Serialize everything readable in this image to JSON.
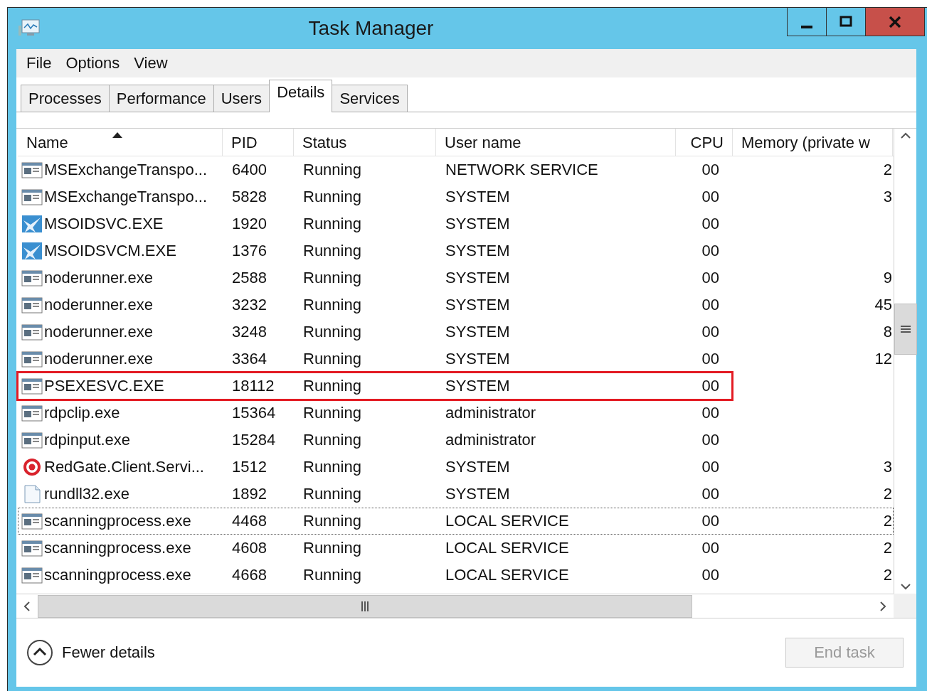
{
  "window": {
    "title": "Task Manager",
    "controls": [
      {
        "kind": "minimize"
      },
      {
        "kind": "maximize"
      },
      {
        "kind": "close"
      }
    ]
  },
  "menu": [
    "File",
    "Options",
    "View"
  ],
  "tabs": [
    {
      "label": "Processes",
      "selected": false
    },
    {
      "label": "Performance",
      "selected": false
    },
    {
      "label": "Users",
      "selected": false
    },
    {
      "label": "Details",
      "selected": true
    },
    {
      "label": "Services",
      "selected": false
    }
  ],
  "table": {
    "columns": [
      {
        "label": "Name",
        "sorted": true
      },
      {
        "label": "PID",
        "sorted": false
      },
      {
        "label": "Status",
        "sorted": false
      },
      {
        "label": "User name",
        "sorted": false
      },
      {
        "label": "CPU",
        "sorted": false
      },
      {
        "label": "Memory (private w",
        "sorted": false
      }
    ],
    "rows": [
      {
        "kind": "app",
        "name": "MSExchangeTranspo...",
        "pid": "6400",
        "status": "Running",
        "user": "NETWORK SERVICE",
        "cpu": "00",
        "memory": "2",
        "highlighted": false,
        "focused": false
      },
      {
        "kind": "app",
        "name": "MSExchangeTranspo...",
        "pid": "5828",
        "status": "Running",
        "user": "SYSTEM",
        "cpu": "00",
        "memory": "3",
        "highlighted": false,
        "focused": false
      },
      {
        "kind": "bird",
        "name": "MSOIDSVC.EXE",
        "pid": "1920",
        "status": "Running",
        "user": "SYSTEM",
        "cpu": "00",
        "highlighted": false,
        "focused": false
      },
      {
        "kind": "bird",
        "name": "MSOIDSVCM.EXE",
        "pid": "1376",
        "status": "Running",
        "user": "SYSTEM",
        "cpu": "00",
        "highlighted": false,
        "focused": false
      },
      {
        "kind": "app",
        "name": "noderunner.exe",
        "pid": "2588",
        "status": "Running",
        "user": "SYSTEM",
        "cpu": "00",
        "memory": "9",
        "highlighted": false,
        "focused": false
      },
      {
        "kind": "app",
        "name": "noderunner.exe",
        "pid": "3232",
        "status": "Running",
        "user": "SYSTEM",
        "cpu": "00",
        "memory": "45",
        "highlighted": false,
        "focused": false
      },
      {
        "kind": "app",
        "name": "noderunner.exe",
        "pid": "3248",
        "status": "Running",
        "user": "SYSTEM",
        "cpu": "00",
        "memory": "8",
        "highlighted": false,
        "focused": false
      },
      {
        "kind": "app",
        "name": "noderunner.exe",
        "pid": "3364",
        "status": "Running",
        "user": "SYSTEM",
        "cpu": "00",
        "memory": "12",
        "highlighted": false,
        "focused": false
      },
      {
        "kind": "app",
        "name": "PSEXESVC.EXE",
        "pid": "18112",
        "status": "Running",
        "user": "SYSTEM",
        "cpu": "00",
        "highlighted": true,
        "focused": false
      },
      {
        "kind": "app",
        "name": "rdpclip.exe",
        "pid": "15364",
        "status": "Running",
        "user": "administrator",
        "cpu": "00",
        "highlighted": false,
        "focused": false
      },
      {
        "kind": "app",
        "name": "rdpinput.exe",
        "pid": "15284",
        "status": "Running",
        "user": "administrator",
        "cpu": "00",
        "highlighted": false,
        "focused": false
      },
      {
        "kind": "target",
        "name": "RedGate.Client.Servi...",
        "pid": "1512",
        "status": "Running",
        "user": "SYSTEM",
        "cpu": "00",
        "memory": "3",
        "highlighted": false,
        "focused": false
      },
      {
        "kind": "document",
        "name": "rundll32.exe",
        "pid": "1892",
        "status": "Running",
        "user": "SYSTEM",
        "cpu": "00",
        "memory": "2",
        "highlighted": false,
        "focused": false
      },
      {
        "kind": "app",
        "name": "scanningprocess.exe",
        "pid": "4468",
        "status": "Running",
        "user": "LOCAL SERVICE",
        "cpu": "00",
        "memory": "2",
        "highlighted": false,
        "focused": true
      },
      {
        "kind": "app",
        "name": "scanningprocess.exe",
        "pid": "4608",
        "status": "Running",
        "user": "LOCAL SERVICE",
        "cpu": "00",
        "memory": "2",
        "highlighted": false,
        "focused": false
      },
      {
        "kind": "app",
        "name": "scanningprocess.exe",
        "pid": "4668",
        "status": "Running",
        "user": "LOCAL SERVICE",
        "cpu": "00",
        "memory": "2",
        "highlighted": false,
        "focused": false
      }
    ]
  },
  "footer": {
    "toggle": "Fewer details",
    "end_task": {
      "label": "End task",
      "disabled": true
    }
  }
}
